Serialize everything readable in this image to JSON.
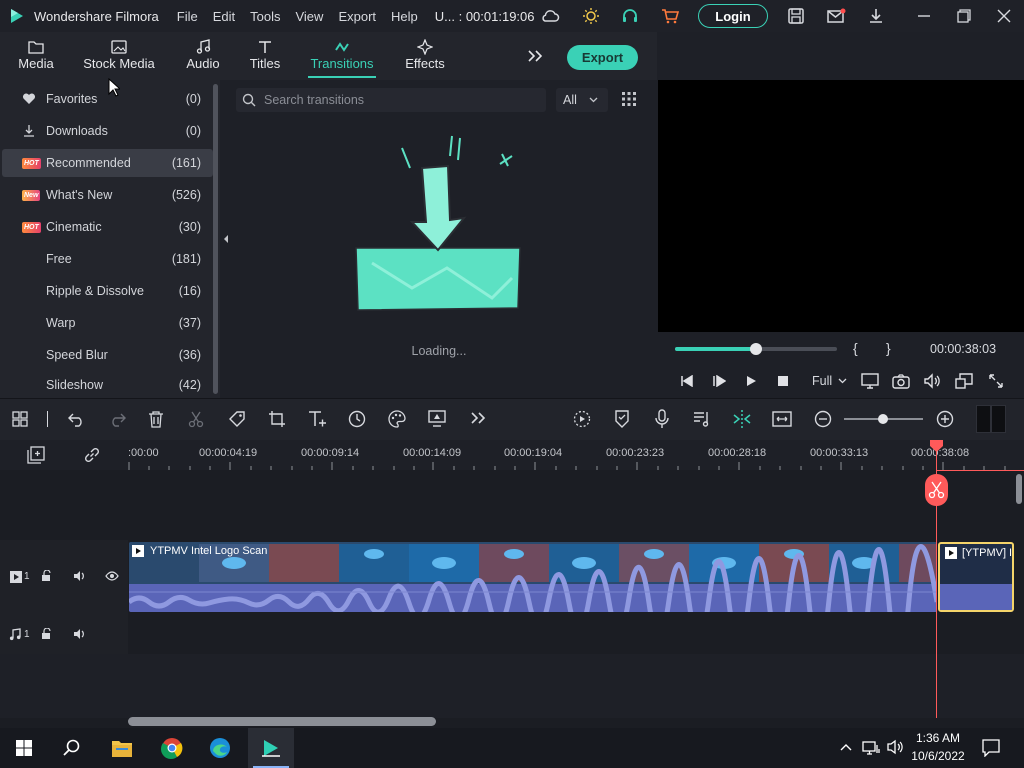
{
  "app": {
    "title": "Wondershare Filmora",
    "project": "U... : 00:01:19:06"
  },
  "menu": [
    "File",
    "Edit",
    "Tools",
    "View",
    "Export",
    "Help"
  ],
  "login_label": "Login",
  "tabs": [
    {
      "label": "Media",
      "icon": "folder-icon"
    },
    {
      "label": "Stock Media",
      "icon": "image-icon"
    },
    {
      "label": "Audio",
      "icon": "music-note-icon"
    },
    {
      "label": "Titles",
      "icon": "text-icon"
    },
    {
      "label": "Transitions",
      "icon": "transition-icon",
      "active": true
    },
    {
      "label": "Effects",
      "icon": "sparkle-icon"
    }
  ],
  "export_label": "Export",
  "categories": [
    {
      "label": "Favorites",
      "count": "(0)",
      "icon": "heart-icon"
    },
    {
      "label": "Downloads",
      "count": "(0)",
      "icon": "download-icon"
    },
    {
      "label": "Recommended",
      "count": "(161)",
      "badge": "HOT",
      "selected": true
    },
    {
      "label": "What's New",
      "count": "(526)",
      "badge": "New"
    },
    {
      "label": "Cinematic",
      "count": "(30)",
      "badge": "HOT"
    },
    {
      "label": "Free",
      "count": "(181)"
    },
    {
      "label": "Ripple & Dissolve",
      "count": "(16)"
    },
    {
      "label": "Warp",
      "count": "(37)"
    },
    {
      "label": "Speed Blur",
      "count": "(36)"
    },
    {
      "label": "Slideshow",
      "count": "(42)"
    }
  ],
  "search": {
    "placeholder": "Search transitions"
  },
  "filter": {
    "value": "All"
  },
  "loading_text": "Loading...",
  "preview": {
    "timecode": "00:00:38:03",
    "quality": "Full",
    "progress": 0.5,
    "bracket_in": "{",
    "bracket_out": "}"
  },
  "ruler_labels": [
    ":00:00",
    "00:00:04:19",
    "00:00:09:14",
    "00:00:14:09",
    "00:00:19:04",
    "00:00:23:23",
    "00:00:28:18",
    "00:00:33:13",
    "00:00:38:08"
  ],
  "tracks": {
    "video_label": "1",
    "audio_label": "1"
  },
  "clips": [
    {
      "title": "YTPMV Intel Logo Scan"
    },
    {
      "title": "[YTPMV] I..."
    }
  ],
  "colors": {
    "accent": "#3ad1b6",
    "playhead": "#ff5a5a",
    "clip_selected": "#f5d46a"
  },
  "clock": {
    "time": "1:36 AM",
    "date": "10/6/2022"
  }
}
